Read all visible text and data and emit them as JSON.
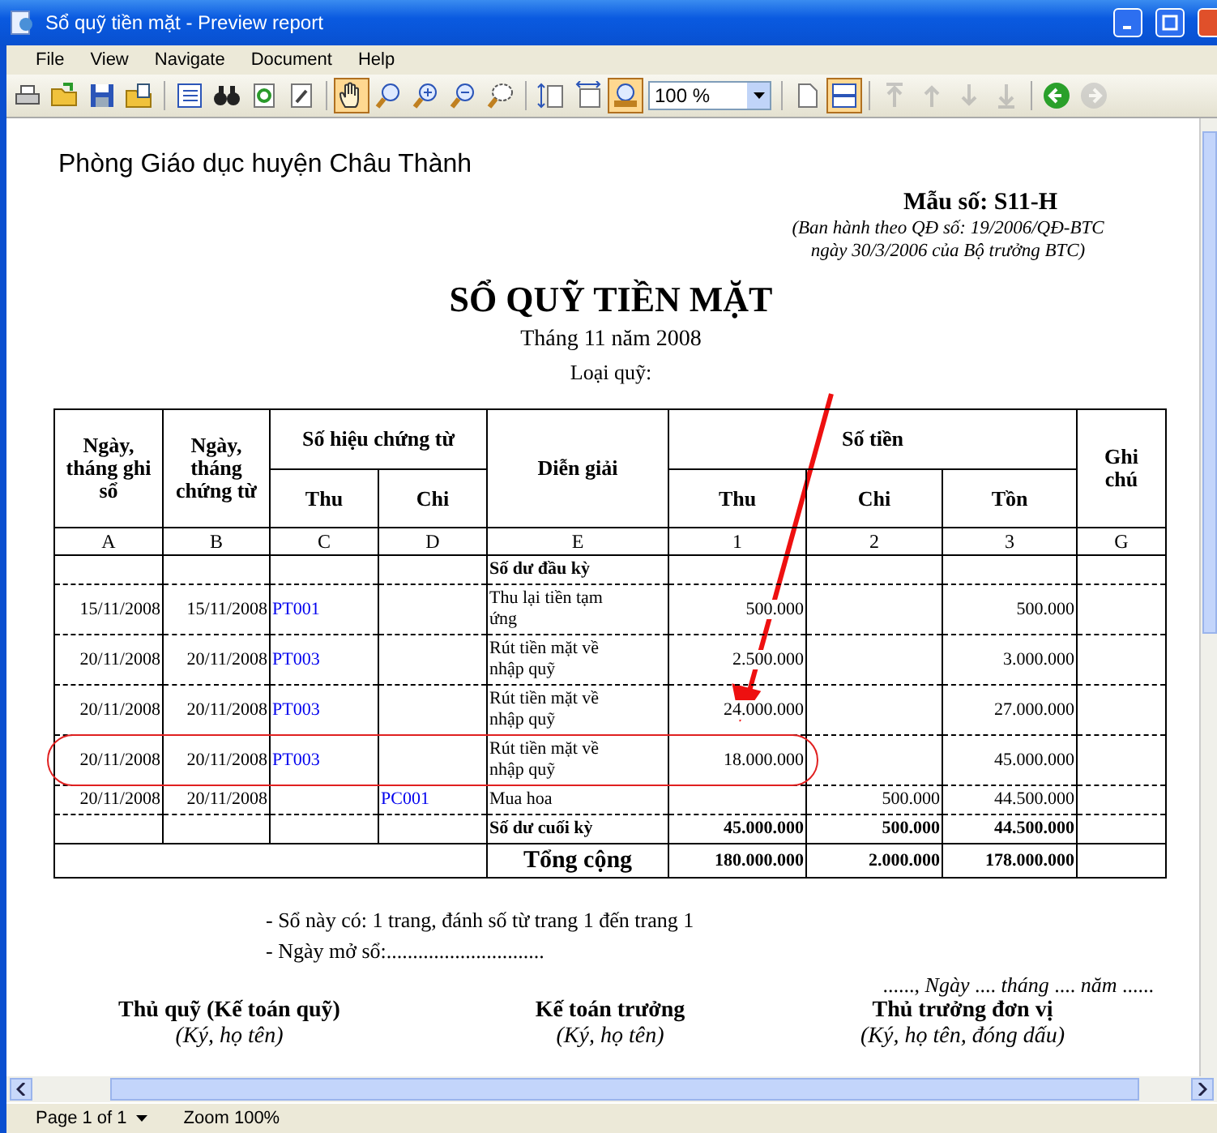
{
  "window": {
    "title": "Sổ quỹ tiền mặt - Preview report"
  },
  "menu": [
    "File",
    "View",
    "Navigate",
    "Document",
    "Help"
  ],
  "toolbar": [
    {
      "kind": "print",
      "pressed": false,
      "disabled": false
    },
    {
      "kind": "open",
      "pressed": false,
      "disabled": false
    },
    {
      "kind": "save",
      "pressed": false,
      "disabled": false
    },
    {
      "kind": "export",
      "pressed": false,
      "disabled": false
    },
    {
      "kind": "separator"
    },
    {
      "kind": "outline",
      "pressed": false,
      "disabled": false
    },
    {
      "kind": "find",
      "pressed": false,
      "disabled": false
    },
    {
      "kind": "refresh",
      "pressed": false,
      "disabled": false
    },
    {
      "kind": "setup",
      "pressed": false,
      "disabled": false
    },
    {
      "kind": "separator"
    },
    {
      "kind": "hand",
      "pressed": true,
      "disabled": false
    },
    {
      "kind": "zoom",
      "pressed": false,
      "disabled": false
    },
    {
      "kind": "zoom-in",
      "pressed": false,
      "disabled": false
    },
    {
      "kind": "zoom-out",
      "pressed": false,
      "disabled": false
    },
    {
      "kind": "zoom-rect",
      "pressed": false,
      "disabled": false
    },
    {
      "kind": "separator"
    },
    {
      "kind": "fit-height",
      "pressed": false,
      "disabled": false
    },
    {
      "kind": "fit-width",
      "pressed": false,
      "disabled": false
    },
    {
      "kind": "zoom-100",
      "pressed": true,
      "disabled": false
    },
    {
      "kind": "zoom-field",
      "value": "100 %"
    },
    {
      "kind": "separator"
    },
    {
      "kind": "single-page",
      "pressed": false,
      "disabled": false
    },
    {
      "kind": "multi-page",
      "pressed": true,
      "disabled": false
    },
    {
      "kind": "separator"
    },
    {
      "kind": "first",
      "pressed": false,
      "disabled": true
    },
    {
      "kind": "prev",
      "pressed": false,
      "disabled": true
    },
    {
      "kind": "next",
      "pressed": false,
      "disabled": true
    },
    {
      "kind": "last",
      "pressed": false,
      "disabled": true
    },
    {
      "kind": "separator"
    },
    {
      "kind": "back",
      "pressed": false,
      "disabled": false
    },
    {
      "kind": "forward",
      "pressed": false,
      "disabled": true
    }
  ],
  "report": {
    "organization": "Phòng Giáo dục huyện Châu Thành",
    "form_number": "Mẫu số: S11-H",
    "form_note": [
      "(Ban hành theo QĐ số: 19/2006/QĐ-BTC",
      "ngày 30/3/2006 của Bộ trưởng BTC)"
    ],
    "title": "SỔ QUỸ TIỀN MẶT",
    "period": "Tháng 11 năm 2008",
    "fund_type": "Loại quỹ:",
    "table": {
      "header": {
        "date_recorded": "Ngày, tháng ghi sổ",
        "date_voucher": "Ngày, tháng chứng từ",
        "voucher_group": "Số hiệu chứng từ",
        "voucher_in": "Thu",
        "voucher_out": "Chi",
        "description": "Diễn giải",
        "amount_group": "Số tiền",
        "amount_in": "Thu",
        "amount_out": "Chi",
        "balance": "Tồn",
        "note": "Ghi chú"
      },
      "column_codes": [
        "A",
        "B",
        "C",
        "D",
        "E",
        "1",
        "2",
        "3",
        "G"
      ],
      "rows": [
        {
          "kind": "balance",
          "description": "Số dư đầu kỳ",
          "highlighted": false
        },
        {
          "kind": "entry",
          "date_recorded": "15/11/2008",
          "date_voucher": "15/11/2008",
          "voucher_in": "PT001",
          "description": "Thu lại tiền tạm ứng",
          "amount_in": "500.000",
          "balance": "500.000",
          "highlighted": false
        },
        {
          "kind": "entry",
          "date_recorded": "20/11/2008",
          "date_voucher": "20/11/2008",
          "voucher_in": "PT003",
          "description": "Rút tiền mặt về nhập quỹ",
          "amount_in": "2.500.000",
          "balance": "3.000.000",
          "highlighted": false
        },
        {
          "kind": "entry",
          "date_recorded": "20/11/2008",
          "date_voucher": "20/11/2008",
          "voucher_in": "PT003",
          "description": "Rút tiền mặt về nhập quỹ",
          "amount_in": "24.000.000",
          "balance": "27.000.000",
          "highlighted": false
        },
        {
          "kind": "entry",
          "date_recorded": "20/11/2008",
          "date_voucher": "20/11/2008",
          "voucher_in": "PT003",
          "description": "Rút tiền mặt về nhập quỹ",
          "amount_in": "18.000.000",
          "balance": "45.000.000",
          "highlighted": true
        },
        {
          "kind": "entry",
          "date_recorded": "20/11/2008",
          "date_voucher": "20/11/2008",
          "voucher_out": "PC001",
          "description": "Mua hoa",
          "amount_out": "500.000",
          "balance": "44.500.000",
          "highlighted": false
        },
        {
          "kind": "balance",
          "description": "Số dư cuối kỳ",
          "amount_in": "45.000.000",
          "amount_out": "500.000",
          "balance": "44.500.000",
          "highlighted": false
        },
        {
          "kind": "total",
          "description": "Tổng cộng",
          "amount_in": "180.000.000",
          "amount_out": "2.000.000",
          "balance": "178.000.000",
          "highlighted": false
        }
      ]
    },
    "notes": [
      "- Sổ này có: 1 trang, đánh số từ trang 1 đến trang 1",
      "- Ngày mở sổ:.............................."
    ],
    "date_line": "......, *Ngày* .... *tháng* .... *năm* ......",
    "signatures": [
      {
        "role": "Thủ quỹ (Kế toán quỹ)",
        "hint": "(Ký, họ tên)"
      },
      {
        "role": "Kế toán trưởng",
        "hint": "(Ký, họ tên)"
      },
      {
        "role": "Thủ trưởng đơn vị",
        "hint": "(Ký, họ tên, đóng dấu)"
      }
    ]
  },
  "status_bar": {
    "page": "Page 1 of 1",
    "zoom": "Zoom 100%"
  }
}
